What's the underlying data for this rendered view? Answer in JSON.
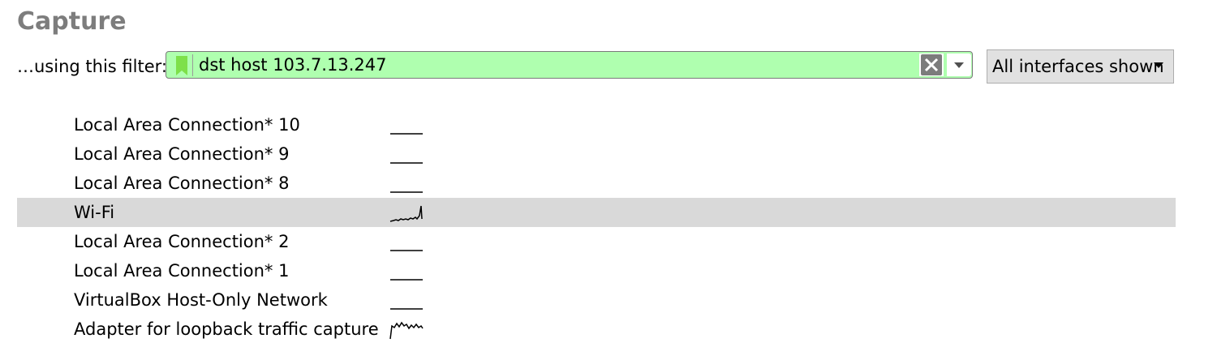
{
  "title": "Capture",
  "filter": {
    "label": "…using this filter:",
    "value": "dst host 103.7.13.247",
    "bookmark_icon": "bookmark-icon",
    "clear_icon": "clear-icon",
    "dropdown_icon": "chevron-down-icon",
    "background": "#afffaf"
  },
  "interfaces_select": {
    "label": "All interfaces shown"
  },
  "interfaces": [
    {
      "name": "Local Area Connection* 10",
      "activity": "flat"
    },
    {
      "name": "Local Area Connection* 9",
      "activity": "flat"
    },
    {
      "name": "Local Area Connection* 8",
      "activity": "flat"
    },
    {
      "name": "Wi-Fi",
      "activity": "wifi",
      "selected": true
    },
    {
      "name": "Local Area Connection* 2",
      "activity": "flat"
    },
    {
      "name": "Local Area Connection* 1",
      "activity": "flat"
    },
    {
      "name": "VirtualBox Host-Only Network",
      "activity": "flat"
    },
    {
      "name": "Adapter for loopback traffic capture",
      "activity": "loopback"
    }
  ]
}
